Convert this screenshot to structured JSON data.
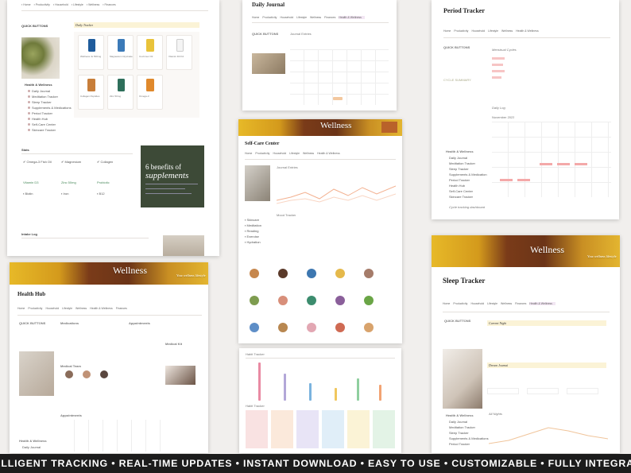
{
  "footer": {
    "tagline": "INTELLIGENT TRACKING • REAL-TIME UPDATES • INSTANT DOWNLOAD • EASY TO USE • CUSTOMIZABLE • FULLY INTEGRATED"
  },
  "supplement_page": {
    "quick_buttons": "QUICK BUTTONS",
    "daily_tracker": "Daily Tracker",
    "sidebar_heading": "Health & Wellness",
    "sidebar_items": [
      "Daily Journal",
      "Meditation Tracker",
      "Sleep Tracker",
      "Supplements & Medications",
      "Period Tracker",
      "Health Hub",
      "Self-Care Center",
      "Skincare Tracker"
    ],
    "products": [
      "Wellness 4x 500mg",
      "Magnesium Glycinate",
      "Cod Liver Oil",
      "Vitamin D3 K2",
      "Collagen Peptides",
      "Zinc 50mg",
      "Omega-3",
      "Probiotic"
    ],
    "stats_heading": "Stats",
    "intake_log": "Intake Log",
    "promo_line1": "6 benefits of",
    "promo_line2": "supplements"
  },
  "journal_page": {
    "title": "Daily Journal",
    "nav": [
      "Home",
      "Productivity",
      "Household",
      "Lifestyle",
      "Wellness",
      "Finances",
      "Health & Wellness"
    ],
    "quick_buttons": "QUICK BUTTONS",
    "journal_entries": "Journal Entries"
  },
  "period_page": {
    "title": "Period Tracker",
    "nav": [
      "Home",
      "Productivity",
      "Household",
      "Lifestyle",
      "Wellness",
      "Health & Wellness"
    ],
    "quick_buttons": "QUICK BUTTONS",
    "cycle_summary": "CYCLE SUMMARY",
    "menstrual_cycles": "Menstrual Cycles",
    "daily_log": "Daily Log",
    "sidebar_heading": "Health & Wellness",
    "sidebar_items": [
      "Daily Journal",
      "Meditation Tracker",
      "Sleep Tracker",
      "Supplements & Medication",
      "Period Tracker",
      "Health Hub",
      "Self-Care Center",
      "Skincare Tracker"
    ],
    "month": "November 2023",
    "cycle_tracking": "Cycle tracking dashboard"
  },
  "selfcare_page": {
    "banner": "Wellness",
    "title": "Self-Care Center",
    "nav": [
      "Home",
      "Productivity",
      "Household",
      "Lifestyle",
      "Wellness",
      "Health & Wellness"
    ],
    "journal_header": "Journal Entries",
    "mood_label": "Mood Tracker"
  },
  "healthhub_page": {
    "banner": "Wellness",
    "banner_sub": "Your wellness lifestyle",
    "title": "Health Hub",
    "nav": [
      "Home",
      "Productivity",
      "Household",
      "Lifestyle",
      "Wellness",
      "Health & Wellness",
      "Finances"
    ],
    "quick_buttons": "QUICK BUTTONS",
    "medications": "Medications",
    "appointments": "Appointments",
    "medical_team": "Medical Team",
    "medical_kit": "Medical Kit",
    "sidebar_heading": "Health & Wellness",
    "sidebar_items": [
      "Daily Journal",
      "Meditation Tracker",
      "Sleep Tracker",
      "Supplements",
      "Period Tracker",
      "Health Hub",
      "Self-Care",
      "Skincare"
    ]
  },
  "habit_page": {
    "header": "Habit Tracker",
    "table_header": "Habit Tracker"
  },
  "sleep_page": {
    "banner": "Wellness",
    "banner_sub": "Your wellness lifestyle",
    "title": "Sleep Tracker",
    "nav": [
      "Home",
      "Productivity",
      "Household",
      "Lifestyle",
      "Wellness",
      "Finances",
      "Health & Wellness"
    ],
    "quick_buttons": "QUICK BUTTONS",
    "current_night": "Current Night",
    "dream_journal": "Dream Journal",
    "sidebar_heading": "Health & Wellness",
    "sidebar_items": [
      "Daily Journal",
      "Meditation Tracker",
      "Sleep Tracker",
      "Supplements & Medications",
      "Period Tracker",
      "Health Hub",
      "Self-Care Center"
    ],
    "all_nights": "All Nights"
  },
  "colors": {
    "accent_yellow": "#fbf3d6",
    "banner_brown": "#6b3417",
    "banner_gold": "#e3b530",
    "promo_green": "#3d4a37",
    "footer": "#1c1c1c"
  }
}
